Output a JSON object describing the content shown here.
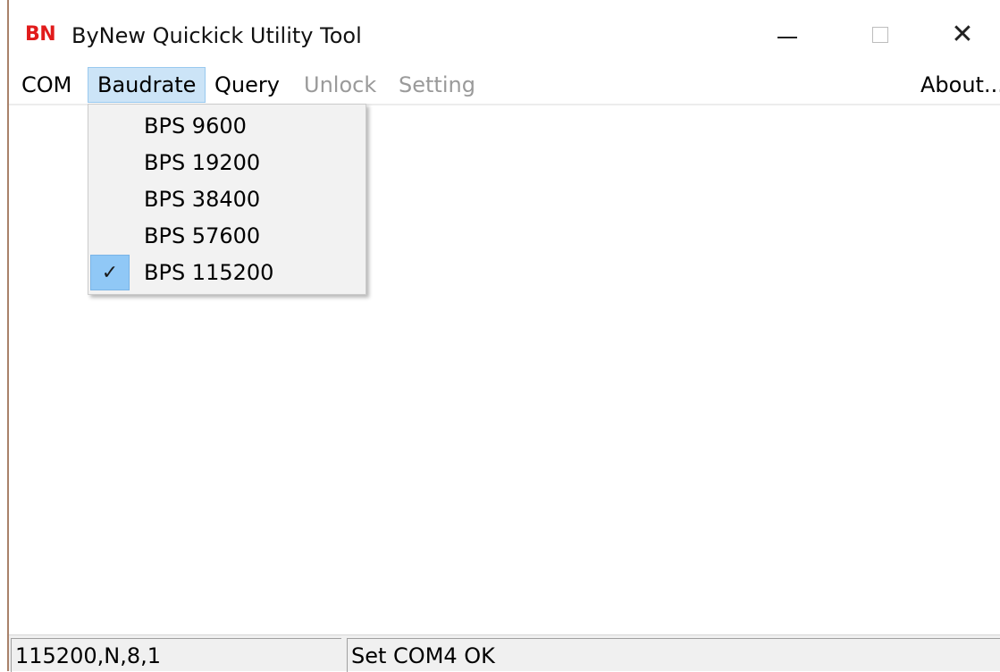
{
  "window": {
    "logo": "BN",
    "title": "ByNew Quickick Utility Tool",
    "minimize_icon": "minimize-icon",
    "maximize_icon": "maximize-icon",
    "close_icon": "close-icon",
    "close_glyph": "✕"
  },
  "menu": {
    "com": "COM",
    "baudrate": "Baudrate",
    "query": "Query",
    "unlock": "Unlock",
    "setting": "Setting",
    "about": "About..."
  },
  "baudrate_menu": {
    "items": [
      {
        "label": "BPS 9600",
        "checked": false
      },
      {
        "label": "BPS 19200",
        "checked": false
      },
      {
        "label": "BPS 38400",
        "checked": false
      },
      {
        "label": "BPS 57600",
        "checked": false
      },
      {
        "label": "BPS 115200",
        "checked": true
      }
    ],
    "check_glyph": "✓"
  },
  "status": {
    "port_settings": "115200,N,8,1",
    "message": "Set COM4 OK"
  },
  "colors": {
    "logo": "#e11b1b",
    "menu_highlight": "#cce4f7",
    "checked_highlight": "#90c8f6",
    "disabled_text": "#9a9a9a"
  }
}
